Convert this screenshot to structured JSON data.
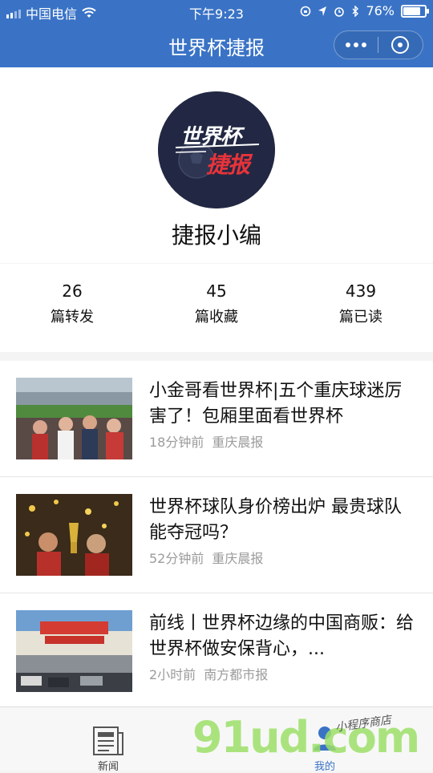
{
  "status_bar": {
    "carrier": "中国电信",
    "time": "下午9:23",
    "battery": "76%",
    "battery_level": 0.76
  },
  "nav": {
    "title": "世界杯捷报"
  },
  "profile": {
    "logo_text_top": "世界杯",
    "logo_text_bottom": "捷报",
    "name": "捷报小编"
  },
  "stats": [
    {
      "value": "26",
      "label": "篇转发"
    },
    {
      "value": "45",
      "label": "篇收藏"
    },
    {
      "value": "439",
      "label": "篇已读"
    }
  ],
  "articles": [
    {
      "title": "小金哥看世界杯|五个重庆球迷厉害了！包厢里面看世界杯",
      "time": "18分钟前",
      "source": "重庆晨报",
      "thumb": "stadium-fans-photo"
    },
    {
      "title": "世界杯球队身价榜出炉 最贵球队能夺冠吗？",
      "time": "52分钟前",
      "source": "重庆晨报",
      "thumb": "trophy-celebration-photo"
    },
    {
      "title": "前线丨世界杯边缘的中国商贩：给世界杯做安保背心，...",
      "time": "2小时前",
      "source": "南方都市报",
      "thumb": "moskva-building-photo"
    }
  ],
  "tabbar": {
    "news_label": "新闻",
    "mine_label": "我的"
  },
  "watermark": {
    "text": "91ud.com",
    "small": "小程序商店"
  },
  "colors": {
    "brand_blue": "#3a73c6",
    "logo_bg": "#222843",
    "logo_red": "#e8333a"
  }
}
